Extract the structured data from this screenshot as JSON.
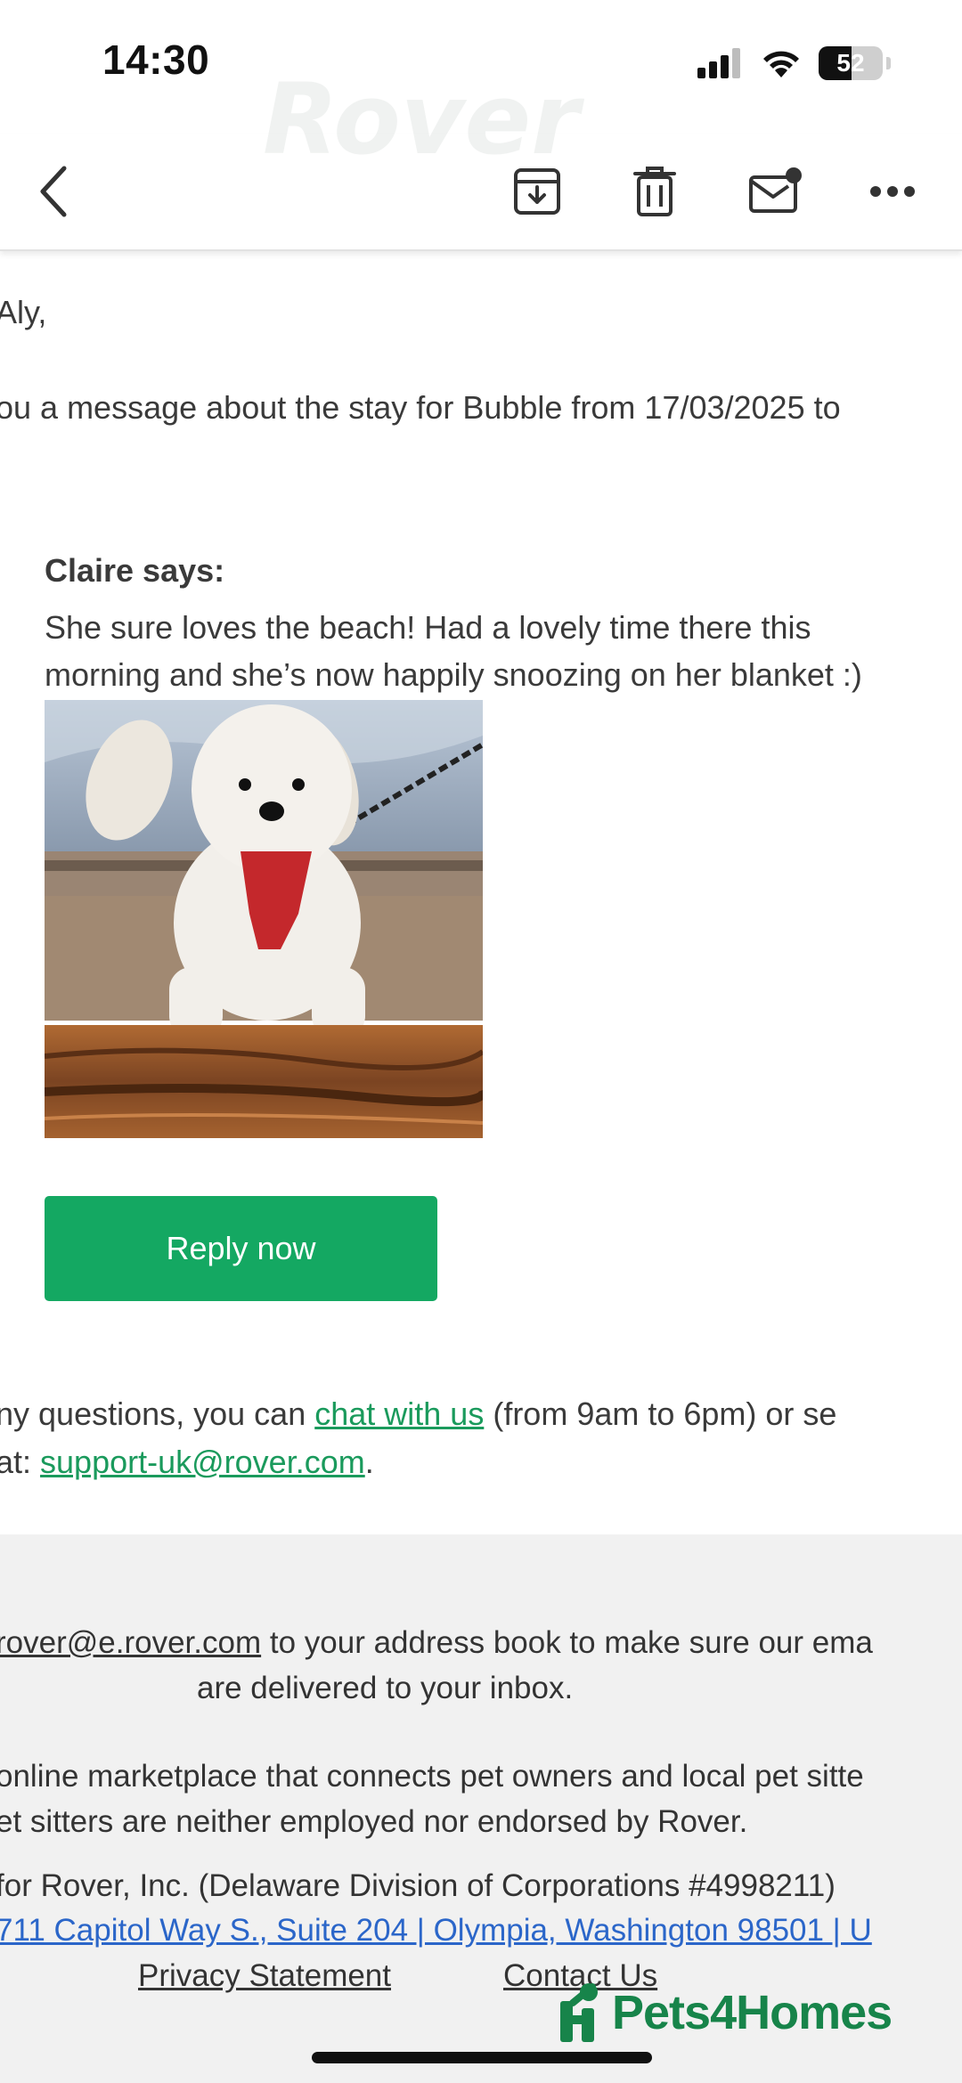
{
  "status_bar": {
    "time": "14:30",
    "battery": "52",
    "battery_level": 0.52
  },
  "watermark": "Rover",
  "toolbar": {
    "back": "back-chevron-icon",
    "archive": "archive-icon",
    "delete": "trash-icon",
    "mark_unread": "mail-unread-icon",
    "more": "more-icon"
  },
  "email": {
    "greeting": "Aly,",
    "intro": "ou a message about the stay for Bubble from 17/03/2025 to",
    "sender_label": "Claire says:",
    "message_line1": "She sure loves the beach! Had a lovely time there this",
    "message_line2": "morning and she’s now happily snoozing on her blanket :)",
    "reply_button": "Reply now",
    "help_prefix": "ny questions, you can ",
    "chat_link": "chat with us",
    "help_suffix": " (from 9am to 6pm) or se",
    "email_prefix": "at: ",
    "support_email": "support-uk@rover.com",
    "email_suffix": "."
  },
  "footer": {
    "address_link": "rover@e.rover.com",
    "address_line1_rest": " to your address book to make sure our ema",
    "address_line2": "are delivered to your inbox.",
    "marketplace_line1": "online marketplace that connects pet owners and local pet sitte",
    "marketplace_line2": "et sitters are neither employed nor endorsed by Rover.",
    "company_line": " for Rover, Inc. (Delaware Division of Corporations #4998211)",
    "address_links": "711 Capitol Way S., Suite 204 | Olympia, Washington 98501 | U",
    "privacy": "Privacy Statement",
    "contact": "Contact Us"
  },
  "branding": {
    "name": "Pets4Homes",
    "color": "#17844a"
  },
  "colors": {
    "accent": "#14a862",
    "link": "#1a9a5c",
    "footer_link": "#2b66c9"
  }
}
